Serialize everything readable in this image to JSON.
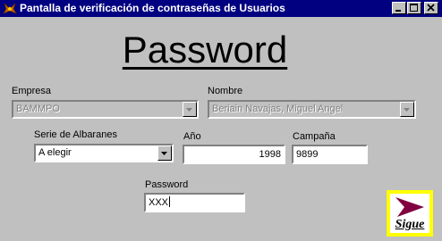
{
  "window": {
    "title": "Pantalla de verificación de contraseñas de Usuarios"
  },
  "heading": "Password",
  "fields": {
    "empresa": {
      "label": "Empresa",
      "value": "BAMMPO"
    },
    "nombre": {
      "label": "Nombre",
      "value": "Beriain Navajas, Miguel Angel"
    },
    "serie": {
      "label": "Serie de Albaranes",
      "value": "A elegir"
    },
    "anio": {
      "label": "Año",
      "value": "1998"
    },
    "campana": {
      "label": "Campaña",
      "value": "9899"
    },
    "password": {
      "label": "Password",
      "value": "XXX"
    }
  },
  "sigue_button": {
    "label": "Sigue"
  },
  "colors": {
    "titlebar": "#000080",
    "window_bg": "#c0c0c0",
    "sigue_border": "#ffff00",
    "sigue_arrow": "#800040"
  }
}
